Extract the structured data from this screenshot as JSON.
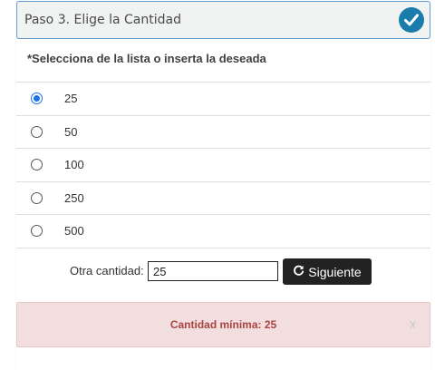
{
  "step": {
    "title": "Paso 3. Elige la Cantidad",
    "status_icon": "check-circle-icon",
    "status_color": "#1a7cab"
  },
  "instruction": "*Selecciona de la lista o inserta la deseada",
  "options": [
    {
      "label": "25",
      "checked": true
    },
    {
      "label": "50",
      "checked": false
    },
    {
      "label": "100",
      "checked": false
    },
    {
      "label": "250",
      "checked": false
    },
    {
      "label": "500",
      "checked": false
    }
  ],
  "custom": {
    "label": "Otra cantidad:",
    "value": "25"
  },
  "next_button": {
    "label": "Siguiente",
    "icon": "refresh-icon"
  },
  "alert": {
    "text": "Cantidad mínima: 25",
    "close": "x",
    "color": "#a94442",
    "background": "#f2dede"
  }
}
